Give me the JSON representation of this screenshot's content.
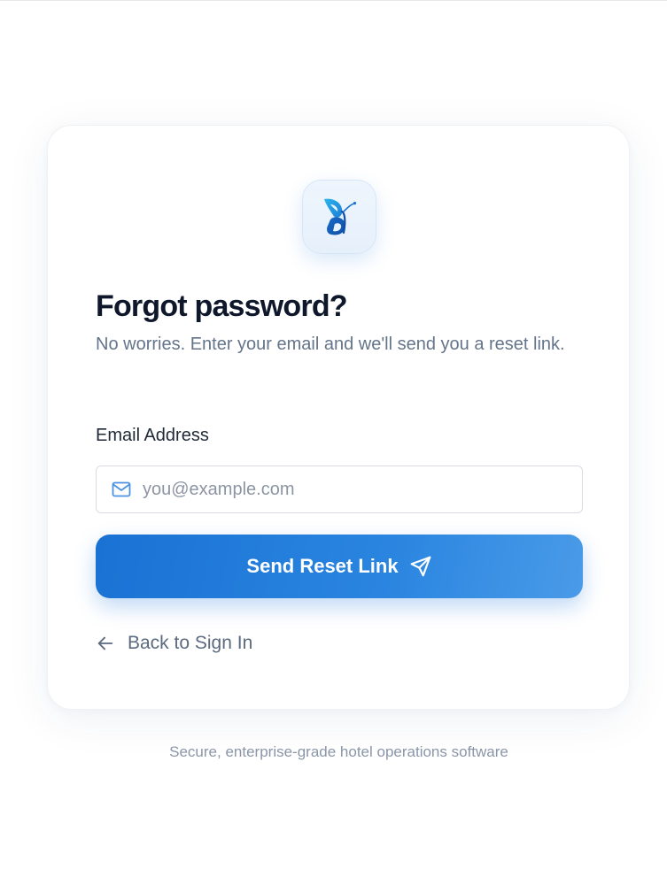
{
  "logo": {
    "icon": "butterfly-icon",
    "accent_color": "#1a72d4",
    "light_color": "#29a8e8"
  },
  "header": {
    "title": "Forgot password?",
    "subtitle": "No worries. Enter your email and we'll send you a reset link."
  },
  "form": {
    "email_label": "Email Address",
    "email_placeholder": "you@example.com",
    "email_value": "",
    "email_icon": "mail-icon",
    "submit_label": "Send Reset Link",
    "submit_icon": "send-icon"
  },
  "back_link": {
    "label": "Back to Sign In",
    "icon": "arrow-left-icon"
  },
  "footer": {
    "note": "Secure, enterprise-grade hotel operations software"
  },
  "colors": {
    "primary": "#1a72d4",
    "title": "#0f172a",
    "muted": "#64748b"
  }
}
